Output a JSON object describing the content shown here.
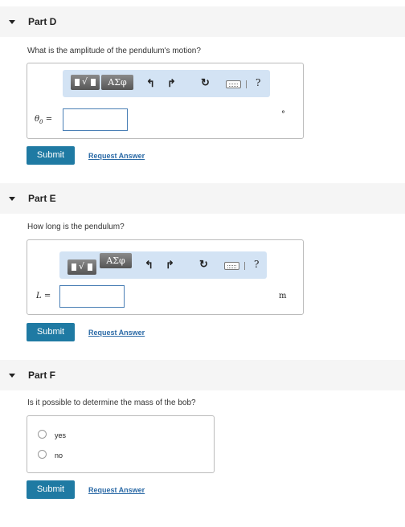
{
  "parts": [
    {
      "title": "Part D",
      "question": "What is the amplitude of the pendulum's motion?",
      "variable": "θ",
      "variable_sub": "0",
      "equals": "=",
      "value": "",
      "unit": "°",
      "submit_label": "Submit",
      "request_label": "Request Answer"
    },
    {
      "title": "Part E",
      "question": "How long is the pendulum?",
      "variable": "L",
      "equals": "=",
      "value": "",
      "unit": "m",
      "submit_label": "Submit",
      "request_label": "Request Answer"
    },
    {
      "title": "Part F",
      "question": "Is it possible to determine the mass of the bob?",
      "options": [
        "yes",
        "no"
      ],
      "submit_label": "Submit",
      "request_label": "Request Answer"
    }
  ],
  "toolbar": {
    "greek_label": "ΑΣφ",
    "radical_label": "√",
    "help_label": "?",
    "undo_icon": "undo-icon",
    "redo_icon": "redo-icon",
    "reset_icon": "reset-icon",
    "keyboard_icon": "keyboard-icon"
  },
  "colors": {
    "submit_bg": "#1f7aa3",
    "link": "#2b6aa6",
    "toolbar_bg": "#d3e3f4",
    "header_bg": "#f5f5f5"
  }
}
